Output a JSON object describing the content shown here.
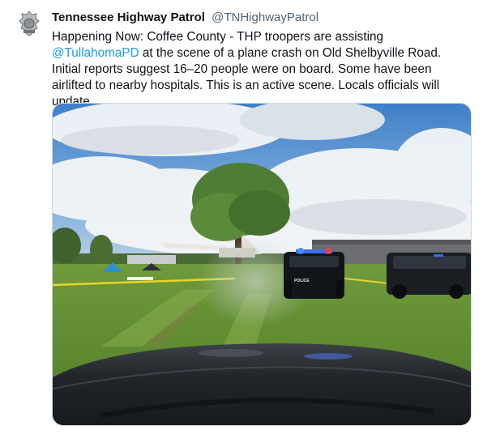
{
  "tweet": {
    "display_name": "Tennessee Highway Patrol",
    "handle": "@TNHighwayPatrol",
    "avatar_icon": "thp-badge-icon",
    "text_part1": "Happening Now: Coffee County - THP troopers are assisting ",
    "mention": "@TullahomaPD",
    "text_part2": " at the scene of a plane crash on Old Shelbyville Road. Initial reports suggest 16–20 people were on board. Some have been airlifted to nearby hospitals. This is an active scene. Locals officials will update."
  },
  "media": {
    "police_car_label": "POLICE"
  },
  "colors": {
    "link": "#1d9bf0",
    "muted": "#536471",
    "text": "#0f1419"
  }
}
